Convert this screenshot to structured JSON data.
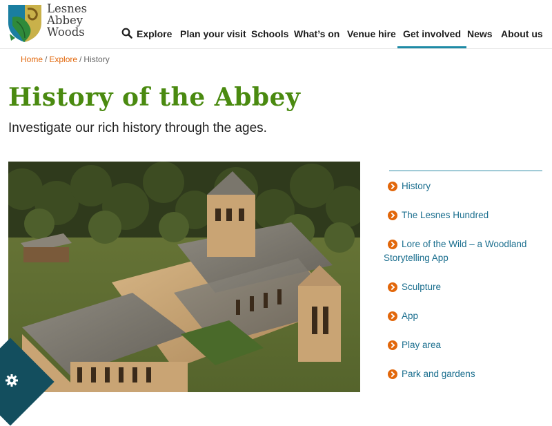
{
  "logo": {
    "line1": "Lesnes",
    "line2": "Abbey",
    "line3": "Woods"
  },
  "nav": {
    "explore": "Explore",
    "plan": "Plan your visit",
    "schools": "Schools",
    "whats_on": "What’s on",
    "venue": "Venue hire",
    "get_involved": "Get involved",
    "news": "News",
    "about": "About us"
  },
  "breadcrumb": {
    "home": "Home",
    "explore": "Explore",
    "current": "History",
    "sep": "/"
  },
  "page": {
    "title": "History of the Abbey",
    "subtitle": "Investigate our rich history through the ages."
  },
  "sidebar": {
    "items": [
      {
        "label": "History"
      },
      {
        "label": "The Lesnes Hundred"
      },
      {
        "label": "Lore of the Wild – a Woodland Storytelling App"
      },
      {
        "label": "Sculpture"
      },
      {
        "label": "App"
      },
      {
        "label": "Play area"
      },
      {
        "label": "Park and gardens"
      }
    ]
  },
  "colors": {
    "title_green": "#4a8a10",
    "link_blue": "#1a6e8e",
    "accent_orange": "#e2670b",
    "nav_active": "#1e8aa6",
    "cookie_bg": "#134e5e"
  },
  "icons": {
    "search": "search-icon",
    "chevron": "chevron-right-icon",
    "cookie": "gear-icon"
  }
}
